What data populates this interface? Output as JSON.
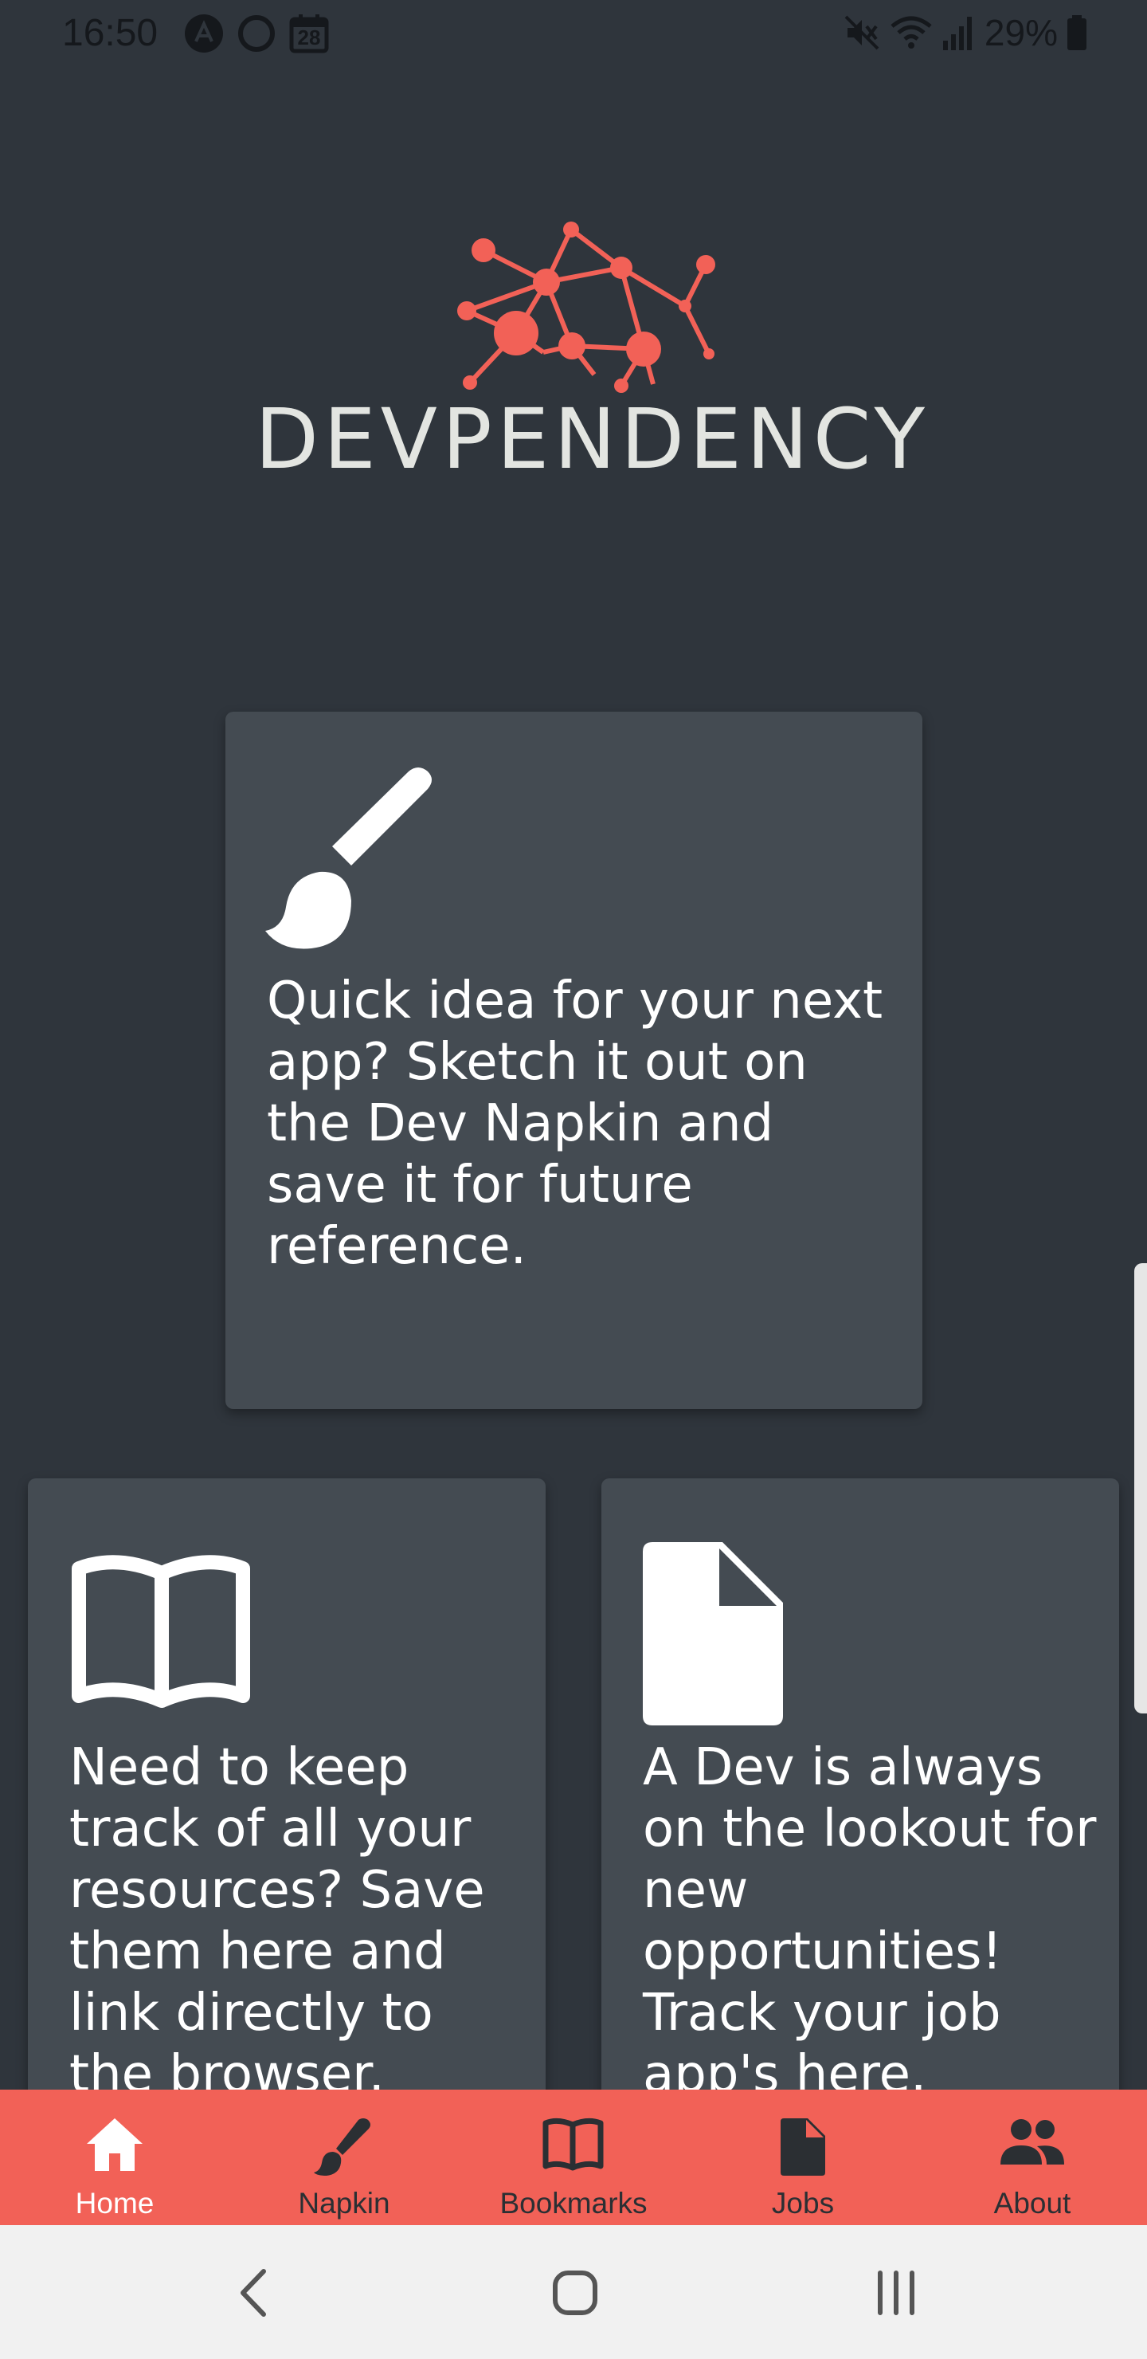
{
  "status_bar": {
    "time": "16:50",
    "calendar_day": "28",
    "battery": "29%",
    "icons_left": [
      "notification-a-icon",
      "ring-icon",
      "calendar-icon"
    ],
    "icons_right": [
      "mute-icon",
      "wifi-icon",
      "signal-icon",
      "battery-icon"
    ]
  },
  "logo": {
    "text": "DEVPENDENCY",
    "accent": "#f26157"
  },
  "cards": {
    "napkin": {
      "icon": "paintbrush-icon",
      "text": "Quick idea for your next app? Sketch it out on the Dev Napkin and save it for future reference."
    },
    "bookmarks": {
      "icon": "open-book-icon",
      "text": "Need to keep track of all your resources? Save them here and link directly to the browser."
    },
    "jobs": {
      "icon": "document-icon",
      "text": "A Dev is always on the lookout for new opportunities! Track your job app's here."
    }
  },
  "bottom_nav": {
    "active": "Home",
    "items": [
      {
        "label": "Home",
        "icon": "home-icon"
      },
      {
        "label": "Napkin",
        "icon": "paintbrush-icon"
      },
      {
        "label": "Bookmarks",
        "icon": "open-book-icon"
      },
      {
        "label": "Jobs",
        "icon": "document-icon"
      },
      {
        "label": "About",
        "icon": "people-icon"
      }
    ]
  },
  "colors": {
    "background": "#2f353c",
    "card": "#444b52",
    "nav": "#f26157",
    "nav_active_text": "#ffffff"
  }
}
